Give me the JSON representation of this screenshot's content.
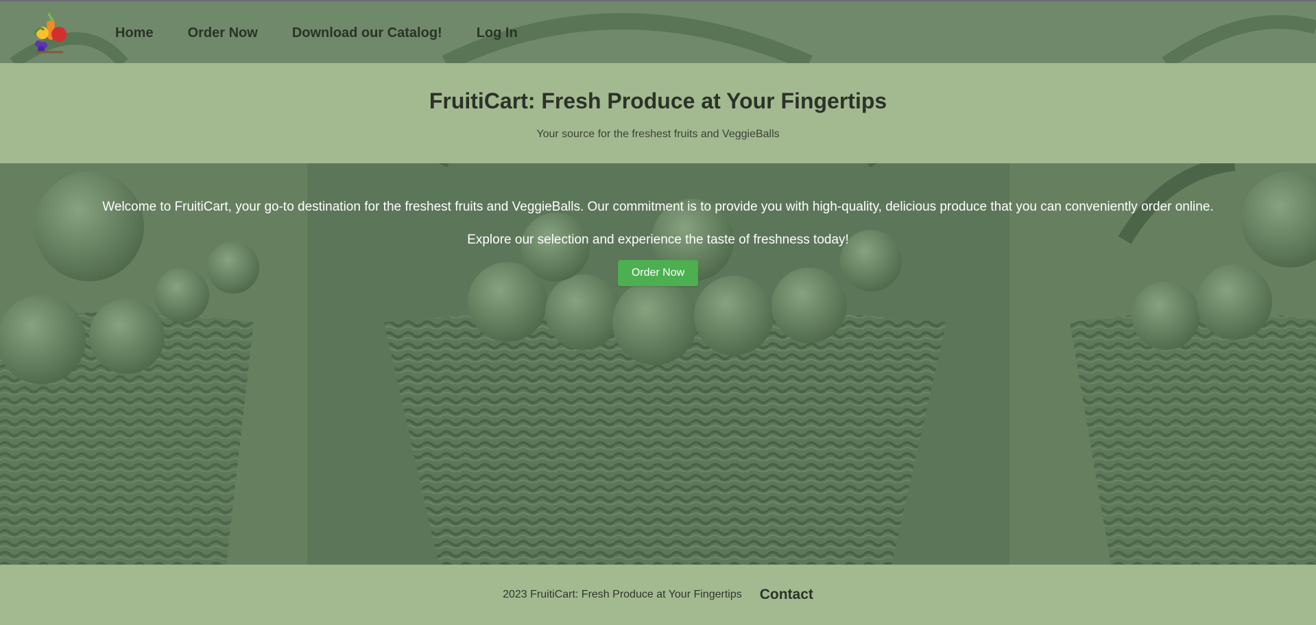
{
  "nav": {
    "logo_icon": "fruit-basket-logo-icon",
    "links": [
      {
        "label": "Home"
      },
      {
        "label": "Order Now"
      },
      {
        "label": "Download our Catalog!"
      },
      {
        "label": "Log In"
      }
    ]
  },
  "header": {
    "title": "FruitiCart: Fresh Produce at Your Fingertips",
    "subtitle": "Your source for the freshest fruits and VeggieBalls"
  },
  "hero": {
    "welcome_text": "Welcome to FruitiCart, your go-to destination for the freshest fruits and VeggieBalls. Our commitment is to provide you with high-quality, delicious produce that you can conveniently order online.",
    "explore_text": "Explore our selection and experience the taste of freshness today!",
    "cta_label": "Order Now"
  },
  "footer": {
    "copyright": "2023 FruitiCart: Fresh Produce at Your Fingertips",
    "contact_label": "Contact"
  },
  "colors": {
    "band_green": "#a3ba91",
    "overlay_green": "#5f7a5c",
    "button_green": "#4caf50",
    "text_dark": "#2b3228",
    "text_light": "#ffffff"
  }
}
